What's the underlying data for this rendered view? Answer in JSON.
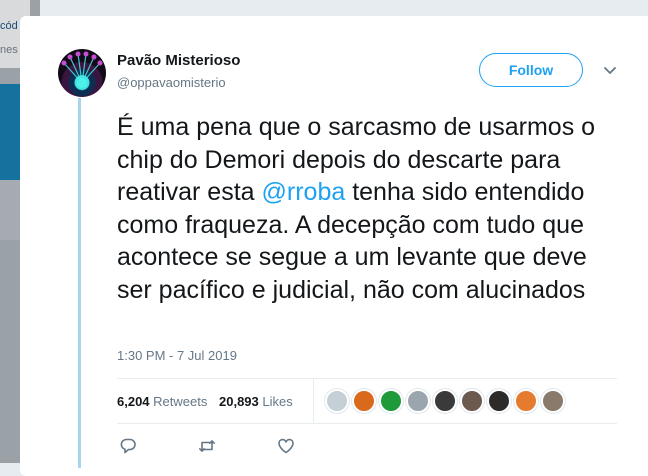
{
  "background": {
    "fragment_1": "cód",
    "fragment_2": "nes"
  },
  "tweet": {
    "display_name": "Pavão Misterioso",
    "handle": "@oppavaomisterio",
    "follow_label": "Follow",
    "text_before": "É uma pena que o sarcasmo de usarmos o chip do Demori depois do descarte para reativar esta ",
    "mention": "@rroba",
    "text_after": " tenha sido entendido como fraqueza. A decepção com tudo que acontece se segue a um levante que deve ser pacífico e judicial, não com alucinados",
    "timestamp": "1:30 PM - 7 Jul 2019",
    "retweets_count": "6,204",
    "retweets_label": "Retweets",
    "likes_count": "20,893",
    "likes_label": "Likes"
  },
  "liker_avatars": [
    {
      "name": "default-profile",
      "color": "#c4cfd6"
    },
    {
      "name": "orange-figure",
      "color": "#d96a1b"
    },
    {
      "name": "brazil-flag",
      "color": "#1f9a3b"
    },
    {
      "name": "face-grey",
      "color": "#9aa5ad"
    },
    {
      "name": "suit-figure",
      "color": "#3a3a3a"
    },
    {
      "name": "man-portrait",
      "color": "#6d5a4e"
    },
    {
      "name": "dark-hair-woman",
      "color": "#2d2a2a"
    },
    {
      "name": "cartoon-girl",
      "color": "#e57b2e"
    },
    {
      "name": "smiling-man",
      "color": "#8a7a6c"
    }
  ],
  "icons": {
    "reply": "reply-icon",
    "retweet": "retweet-icon",
    "like": "heart-icon",
    "menu": "chevron-down-icon"
  },
  "colors": {
    "accent": "#1da1f2",
    "text": "#14171a",
    "secondary": "#657786",
    "thread_line": "#a9d3ef"
  }
}
